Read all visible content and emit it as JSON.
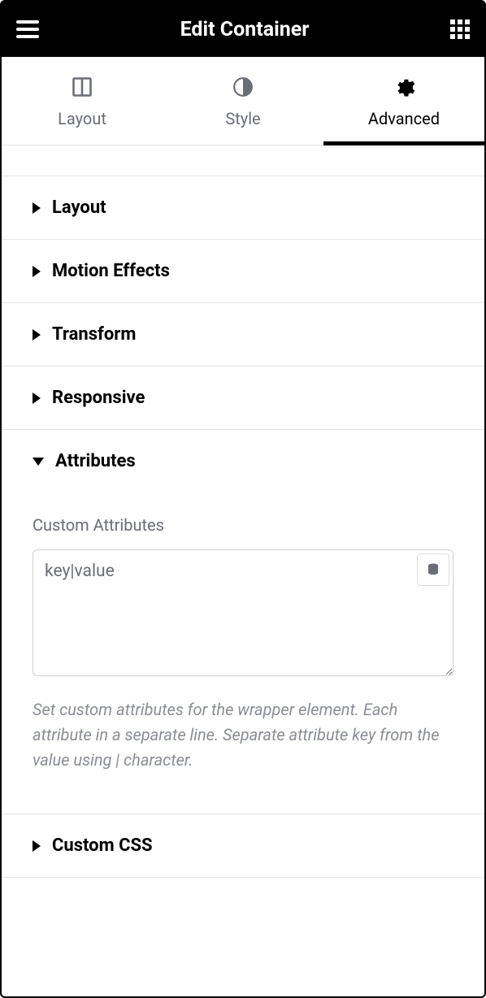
{
  "header": {
    "title": "Edit Container"
  },
  "tabs": [
    {
      "label": "Layout"
    },
    {
      "label": "Style"
    },
    {
      "label": "Advanced"
    }
  ],
  "sections": {
    "layout": "Layout",
    "motion": "Motion Effects",
    "transform": "Transform",
    "responsive": "Responsive",
    "attributes": "Attributes",
    "customcss": "Custom CSS"
  },
  "attributes_panel": {
    "field_label": "Custom Attributes",
    "placeholder": "key|value",
    "value": "",
    "help": "Set custom attributes for the wrapper element. Each attribute in a separate line. Separate attribute key from the value using | character."
  }
}
